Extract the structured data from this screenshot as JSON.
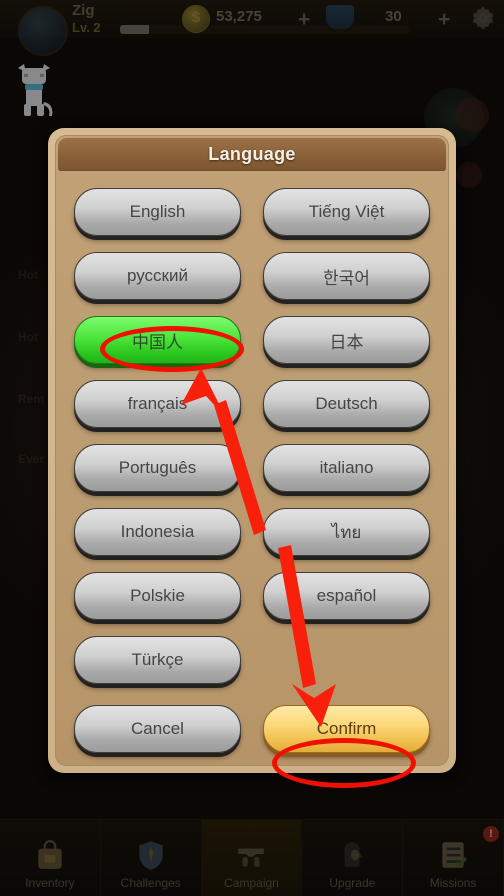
{
  "hud": {
    "player_name": "Zig",
    "level_label": "Lv. 2",
    "coin_value": "53,275",
    "gem_value": "30",
    "coin_icon": "coin-icon",
    "gem_icon": "gem-icon",
    "add_coin_label": "+",
    "add_gem_label": "+",
    "settings_icon": "gear-icon"
  },
  "dialog": {
    "title": "Language",
    "languages": [
      {
        "label": "English",
        "selected": false
      },
      {
        "label": "Tiếng Việt",
        "selected": false
      },
      {
        "label": "русский",
        "selected": false
      },
      {
        "label": "한국어",
        "selected": false
      },
      {
        "label": "中国人",
        "selected": true
      },
      {
        "label": "日本",
        "selected": false
      },
      {
        "label": "français",
        "selected": false
      },
      {
        "label": "Deutsch",
        "selected": false
      },
      {
        "label": "Português",
        "selected": false
      },
      {
        "label": "italiano",
        "selected": false
      },
      {
        "label": "Indonesia",
        "selected": false
      },
      {
        "label": "ไทย",
        "selected": false
      },
      {
        "label": "Polskie",
        "selected": false
      },
      {
        "label": "español",
        "selected": false
      },
      {
        "label": "Türkçe",
        "selected": false
      }
    ],
    "cancel_label": "Cancel",
    "confirm_label": "Confirm"
  },
  "bottom_nav": [
    {
      "label": "Inventory",
      "icon": "backpack-icon",
      "active": false,
      "badge": ""
    },
    {
      "label": "Challenges",
      "icon": "shield-icon",
      "active": false,
      "badge": ""
    },
    {
      "label": "Campaign",
      "icon": "pistols-icon",
      "active": true,
      "badge": ""
    },
    {
      "label": "Upgrade",
      "icon": "hero-icon",
      "active": false,
      "badge": ""
    },
    {
      "label": "Missions",
      "icon": "checklist-icon",
      "active": false,
      "badge": "!"
    }
  ],
  "annotations": {
    "highlight_selected_language": "中国人",
    "highlight_confirm": "Confirm",
    "ellipse_color": "#f01000",
    "arrow_color": "#f8200a",
    "arrow_count": 2
  },
  "colors": {
    "dialog_border": "#d6bb93",
    "dialog_body": "#c2a176",
    "title_bar": "#8a6038",
    "button_face": "#cfcfcf",
    "selected_green": "#4ee53c",
    "confirm_gold": "#fcd97a",
    "background": "#0a0806"
  }
}
